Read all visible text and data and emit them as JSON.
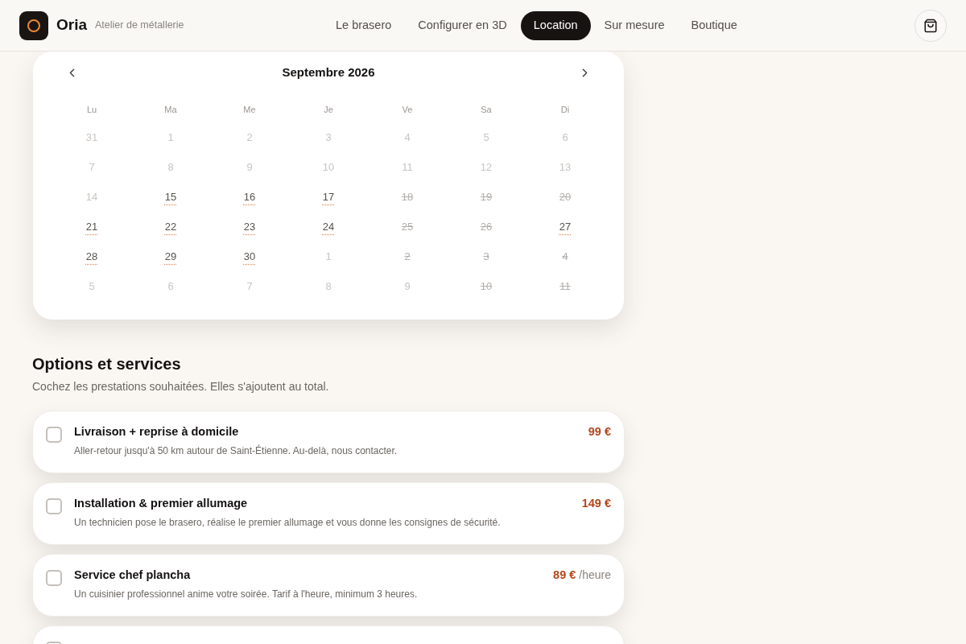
{
  "header": {
    "brand": {
      "name": "Oria",
      "tagline": "Atelier de métallerie"
    },
    "nav": [
      {
        "label": "Le brasero",
        "selected": false
      },
      {
        "label": "Configurer en 3D",
        "selected": false
      },
      {
        "label": "Location",
        "selected": true
      },
      {
        "label": "Sur mesure",
        "selected": false
      },
      {
        "label": "Boutique",
        "selected": false
      }
    ]
  },
  "calendar": {
    "month": "Septembre 2026",
    "weekdays": [
      "Lu",
      "Ma",
      "Me",
      "Je",
      "Ve",
      "Sa",
      "Di"
    ],
    "weeks": [
      [
        {
          "day": "31",
          "available": false,
          "booked": false
        },
        {
          "day": "1",
          "available": false,
          "booked": false
        },
        {
          "day": "2",
          "available": false,
          "booked": false
        },
        {
          "day": "3",
          "available": false,
          "booked": false
        },
        {
          "day": "4",
          "available": false,
          "booked": false
        },
        {
          "day": "5",
          "available": false,
          "booked": false
        },
        {
          "day": "6",
          "available": false,
          "booked": false
        }
      ],
      [
        {
          "day": "7",
          "available": false,
          "booked": false
        },
        {
          "day": "8",
          "available": false,
          "booked": false
        },
        {
          "day": "9",
          "available": false,
          "booked": false
        },
        {
          "day": "10",
          "available": false,
          "booked": false
        },
        {
          "day": "11",
          "available": false,
          "booked": false
        },
        {
          "day": "12",
          "available": false,
          "booked": false
        },
        {
          "day": "13",
          "available": false,
          "booked": false
        }
      ],
      [
        {
          "day": "14",
          "available": false,
          "booked": false
        },
        {
          "day": "15",
          "available": true,
          "booked": false
        },
        {
          "day": "16",
          "available": true,
          "booked": false
        },
        {
          "day": "17",
          "available": true,
          "booked": false
        },
        {
          "day": "18",
          "available": false,
          "booked": true
        },
        {
          "day": "19",
          "available": false,
          "booked": true
        },
        {
          "day": "20",
          "available": false,
          "booked": true
        }
      ],
      [
        {
          "day": "21",
          "available": true,
          "booked": false
        },
        {
          "day": "22",
          "available": true,
          "booked": false
        },
        {
          "day": "23",
          "available": true,
          "booked": false
        },
        {
          "day": "24",
          "available": true,
          "booked": false
        },
        {
          "day": "25",
          "available": false,
          "booked": true
        },
        {
          "day": "26",
          "available": false,
          "booked": true
        },
        {
          "day": "27",
          "available": true,
          "booked": false
        }
      ],
      [
        {
          "day": "28",
          "available": true,
          "booked": false
        },
        {
          "day": "29",
          "available": true,
          "booked": false
        },
        {
          "day": "30",
          "available": true,
          "booked": false
        },
        {
          "day": "1",
          "available": false,
          "booked": false
        },
        {
          "day": "2",
          "available": false,
          "booked": true
        },
        {
          "day": "3",
          "available": false,
          "booked": true
        },
        {
          "day": "4",
          "available": false,
          "booked": true
        }
      ],
      [
        {
          "day": "5",
          "available": false,
          "booked": false
        },
        {
          "day": "6",
          "available": false,
          "booked": false
        },
        {
          "day": "7",
          "available": false,
          "booked": false
        },
        {
          "day": "8",
          "available": false,
          "booked": false
        },
        {
          "day": "9",
          "available": false,
          "booked": false
        },
        {
          "day": "10",
          "available": false,
          "booked": true
        },
        {
          "day": "11",
          "available": false,
          "booked": true
        }
      ]
    ]
  },
  "options": {
    "title": "Options et services",
    "subtitle": "Cochez les prestations souhaitées. Elles s'ajoutent au total.",
    "items": [
      {
        "title": "Livraison + reprise à domicile",
        "description": "Aller-retour jusqu'à 50 km autour de Saint-Étienne. Au-delà, nous contacter.",
        "price": "99 €",
        "checked": false
      },
      {
        "title": "Installation & premier allumage",
        "description": "Un technicien pose le brasero, réalise le premier allumage et vous donne les consignes de sécurité.",
        "price": "149 €",
        "checked": false
      },
      {
        "title": "Service chef plancha",
        "description": "Un cuisinier professionnel anime votre soirée. Tarif à l'heure, minimum 3 heures.",
        "price": "89 €",
        "unit": "/heure",
        "checked": false
      },
      {
        "checked": false
      }
    ]
  }
}
